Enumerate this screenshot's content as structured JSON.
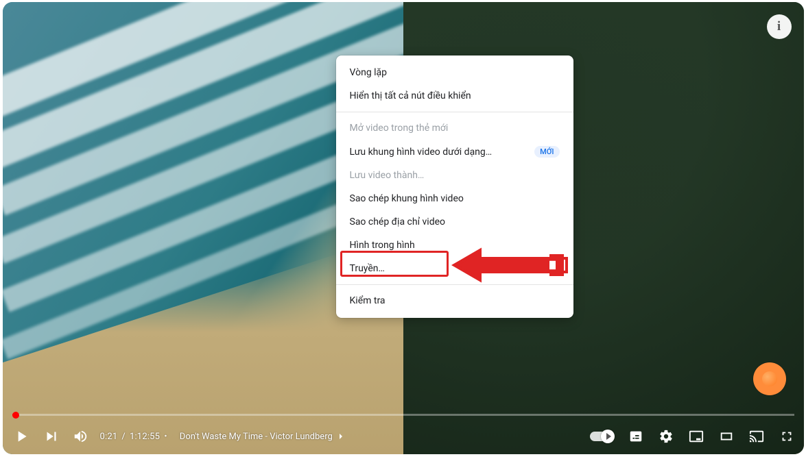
{
  "player": {
    "info_label": "i",
    "time_current": "0:21",
    "time_total": "1:12:55",
    "time_separator": "/",
    "dot_separator": "•",
    "chapter_title": "Don't Waste My Time - Victor Lundberg",
    "progress_fraction": 0.0048
  },
  "context_menu": {
    "items": [
      {
        "label": "Vòng lặp",
        "enabled": true
      },
      {
        "label": "Hiển thị tất cả nút điều khiển",
        "enabled": true
      },
      {
        "divider": true
      },
      {
        "label": "Mở video trong thẻ mới",
        "enabled": false
      },
      {
        "label": "Lưu khung hình video dưới dạng…",
        "enabled": true,
        "badge": "MỚI"
      },
      {
        "label": "Lưu video thành…",
        "enabled": false
      },
      {
        "label": "Sao chép khung hình video",
        "enabled": true
      },
      {
        "label": "Sao chép địa chỉ video",
        "enabled": true
      },
      {
        "label": "Hình trong hình",
        "enabled": true,
        "highlighted": true
      },
      {
        "label": "Truyền…",
        "enabled": true
      },
      {
        "divider": true
      },
      {
        "label": "Kiểm tra",
        "enabled": true
      }
    ]
  }
}
